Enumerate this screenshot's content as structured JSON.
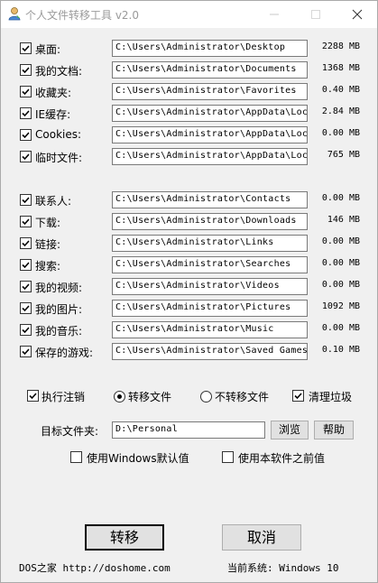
{
  "window": {
    "title": "个人文件转移工具 v2.0"
  },
  "folders_group1": [
    {
      "label": "桌面:",
      "path": "C:\\Users\\Administrator\\Desktop",
      "size": "2288 MB",
      "checked": true
    },
    {
      "label": "我的文档:",
      "path": "C:\\Users\\Administrator\\Documents",
      "size": "1368 MB",
      "checked": true
    },
    {
      "label": "收藏夹:",
      "path": "C:\\Users\\Administrator\\Favorites",
      "size": "0.40 MB",
      "checked": true
    },
    {
      "label": "IE缓存:",
      "path": "C:\\Users\\Administrator\\AppData\\Local",
      "size": "2.84 MB",
      "checked": true
    },
    {
      "label": "Cookies:",
      "path": "C:\\Users\\Administrator\\AppData\\Local",
      "size": "0.00 MB",
      "checked": true
    },
    {
      "label": "临时文件:",
      "path": "C:\\Users\\Administrator\\AppData\\Local",
      "size": "765  MB",
      "checked": true
    }
  ],
  "folders_group2": [
    {
      "label": "联系人:",
      "path": "C:\\Users\\Administrator\\Contacts",
      "size": "0.00 MB",
      "checked": true
    },
    {
      "label": "下载:",
      "path": "C:\\Users\\Administrator\\Downloads",
      "size": "146  MB",
      "checked": true
    },
    {
      "label": "链接:",
      "path": "C:\\Users\\Administrator\\Links",
      "size": "0.00 MB",
      "checked": true
    },
    {
      "label": "搜索:",
      "path": "C:\\Users\\Administrator\\Searches",
      "size": "0.00 MB",
      "checked": true
    },
    {
      "label": "我的视频:",
      "path": "C:\\Users\\Administrator\\Videos",
      "size": "0.00 MB",
      "checked": true
    },
    {
      "label": "我的图片:",
      "path": "C:\\Users\\Administrator\\Pictures",
      "size": "1092 MB",
      "checked": true
    },
    {
      "label": "我的音乐:",
      "path": "C:\\Users\\Administrator\\Music",
      "size": "0.00 MB",
      "checked": true
    },
    {
      "label": "保存的游戏:",
      "path": "C:\\Users\\Administrator\\Saved Games",
      "size": "0.10 MB",
      "checked": true
    }
  ],
  "options": {
    "execute_logoff": "执行注销",
    "move_files": "转移文件",
    "no_move_files": "不转移文件",
    "clean_junk": "清理垃圾",
    "selected_mode": "move_files"
  },
  "target": {
    "label": "目标文件夹:",
    "path": "D:\\Personal",
    "browse_label": "浏览",
    "help_label": "帮助"
  },
  "defaults": {
    "use_windows_default": "使用Windows默认值",
    "use_previous": "使用本软件之前值"
  },
  "actions": {
    "transfer": "转移",
    "cancel": "取消"
  },
  "status": {
    "site": "DOS之家 http://doshome.com",
    "system": "当前系统: Windows 10"
  }
}
